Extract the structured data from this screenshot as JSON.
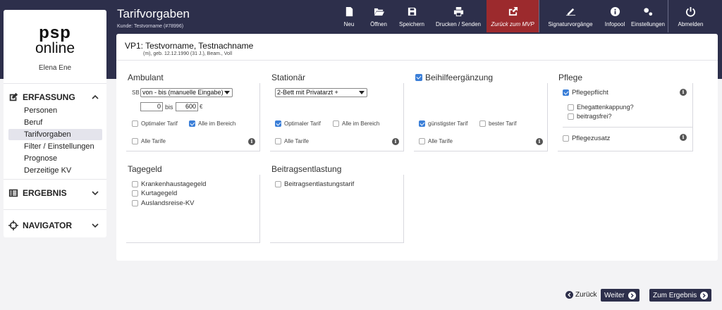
{
  "header": {
    "title": "Tarifvorgaben",
    "customer": "Kunde: Testvorname (#78996)"
  },
  "toolbar": {
    "neu": "Neu",
    "oeffnen": "Öffnen",
    "speichern": "Speichern",
    "drucken": "Drucken / Senden",
    "zurueck_mvp": "Zurück zum MVP",
    "signatur": "Signaturvorgänge",
    "infopool": "Infopool",
    "einstellungen": "Einstellungen",
    "abmelden": "Abmelden"
  },
  "sidebar": {
    "logo_line1": "psp",
    "logo_line2": "online",
    "user": "Elena Ene",
    "erfassung": "ERFASSUNG",
    "items": [
      "Personen",
      "Beruf",
      "Tarifvorgaben",
      "Filter / Einstellungen",
      "Prognose",
      "Derzeitige KV"
    ],
    "ergebnis": "ERGEBNIS",
    "navigator": "NAVIGATOR"
  },
  "person": {
    "title": "VP1: Testvorname, Testnachname",
    "details": "(m), geb. 12.12.1990 (31 J.), Beam., Voll"
  },
  "ambulant": {
    "title": "Ambulant",
    "sb_label": "SB",
    "sb_select": "von - bis (manuelle Eingabe)",
    "from": "0",
    "bis": "bis",
    "to": "600",
    "currency": "€",
    "optimaler": "Optimaler Tarif",
    "alle_bereich": "Alle im Bereich",
    "alle_tarife": "Alle Tarife"
  },
  "stationaer": {
    "title": "Stationär",
    "select": "2-Bett mit Privatarzt +",
    "optimaler": "Optimaler Tarif",
    "alle_bereich": "Alle im Bereich",
    "alle_tarife": "Alle Tarife"
  },
  "beihilfe": {
    "title": "Beihilfeergänzung",
    "guenstigster": "günstigster Tarif",
    "bester": "bester Tarif",
    "alle_tarife": "Alle Tarife"
  },
  "pflege": {
    "title": "Pflege",
    "pflicht": "Pflegepflicht",
    "ehegatten": "Ehegattenkappung?",
    "beitragsfrei": "beitragsfrei?",
    "zusatz": "Pflegezusatz"
  },
  "tagegeld": {
    "title": "Tagegeld",
    "items": [
      "Krankenhaustagegeld",
      "Kurtagegeld",
      "Auslandsreise-KV"
    ]
  },
  "beitrag": {
    "title": "Beitragsentlastung",
    "item": "Beitragsentlastungstarif"
  },
  "footer": {
    "zurueck": "Zurück",
    "weiter": "Weiter",
    "ergebnis": "Zum Ergebnis"
  }
}
